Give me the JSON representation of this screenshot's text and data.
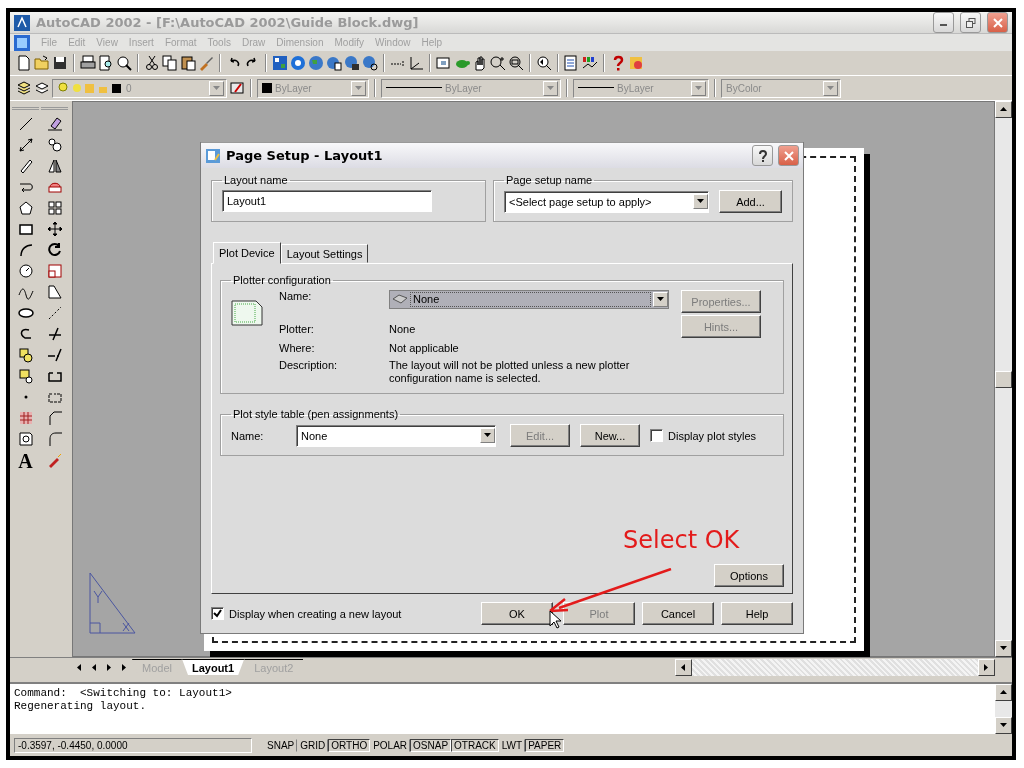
{
  "window": {
    "title": "AutoCAD 2002 - [F:\\AutoCAD 2002\\Guide Block.dwg]"
  },
  "menu": [
    "File",
    "Edit",
    "View",
    "Insert",
    "Format",
    "Tools",
    "Draw",
    "Dimension",
    "Modify",
    "Window",
    "Help"
  ],
  "properties_toolbar": {
    "layer": "0",
    "color_setting": "ByLayer",
    "linetype": "ByLayer",
    "lineweight": "ByLayer",
    "plot_style": "ByColor"
  },
  "draw_toolbar": {
    "text_tool_glyph": "A"
  },
  "dialog": {
    "title": "Page Setup - Layout1",
    "layout_name": {
      "label": "Layout name",
      "value": "Layout1"
    },
    "page_setup_name": {
      "label": "Page setup name",
      "value": "<Select page setup to apply>",
      "button": "Add..."
    },
    "tabs": [
      {
        "label": "Plot Device",
        "selected": true
      },
      {
        "label": "Layout Settings",
        "selected": false
      }
    ],
    "plotter_configuration": {
      "title": "Plotter configuration",
      "name_label": "Name:",
      "name_value": "None",
      "buttons": [
        {
          "label": "Properties...",
          "disabled": true
        },
        {
          "label": "Hints...",
          "disabled": true
        }
      ],
      "rows": [
        {
          "label": "Plotter:",
          "value": "None"
        },
        {
          "label": "Where:",
          "value": "Not applicable"
        },
        {
          "label": "Description:",
          "value": "The layout will not be plotted unless a new plotter configuration name is selected."
        }
      ]
    },
    "plot_style_table": {
      "title": "Plot style table (pen assignments)",
      "name_label": "Name:",
      "value": "None",
      "buttons": [
        {
          "label": "Edit...",
          "disabled": true
        },
        {
          "label": "New...",
          "disabled": false
        }
      ],
      "checkbox": {
        "label": "Display plot styles",
        "checked": false
      }
    },
    "options_button": "Options",
    "display_checkbox": {
      "label": "Display when creating a new layout",
      "checked": true
    },
    "buttons": [
      {
        "label": "OK",
        "disabled": false
      },
      {
        "label": "Plot",
        "disabled": true
      },
      {
        "label": "Cancel",
        "disabled": false
      },
      {
        "label": "Help",
        "disabled": false
      }
    ]
  },
  "annotation": "Select OK",
  "layout_tabs": [
    {
      "label": "Model",
      "selected": false
    },
    {
      "label": "Layout1",
      "selected": true
    },
    {
      "label": "Layout2",
      "selected": false
    }
  ],
  "command_lines": [
    "Command:  <Switching to: Layout1>",
    "Regenerating layout."
  ],
  "status_bar": {
    "coordinates": "-0.3597, -0.4450, 0.0000",
    "toggles": [
      {
        "label": "SNAP",
        "on": false
      },
      {
        "label": "GRID",
        "on": false
      },
      {
        "label": "ORTHO",
        "on": true
      },
      {
        "label": "POLAR",
        "on": false
      },
      {
        "label": "OSNAP",
        "on": true
      },
      {
        "label": "OTRACK",
        "on": true
      },
      {
        "label": "LWT",
        "on": false
      },
      {
        "label": "PAPER",
        "on": true
      }
    ]
  }
}
